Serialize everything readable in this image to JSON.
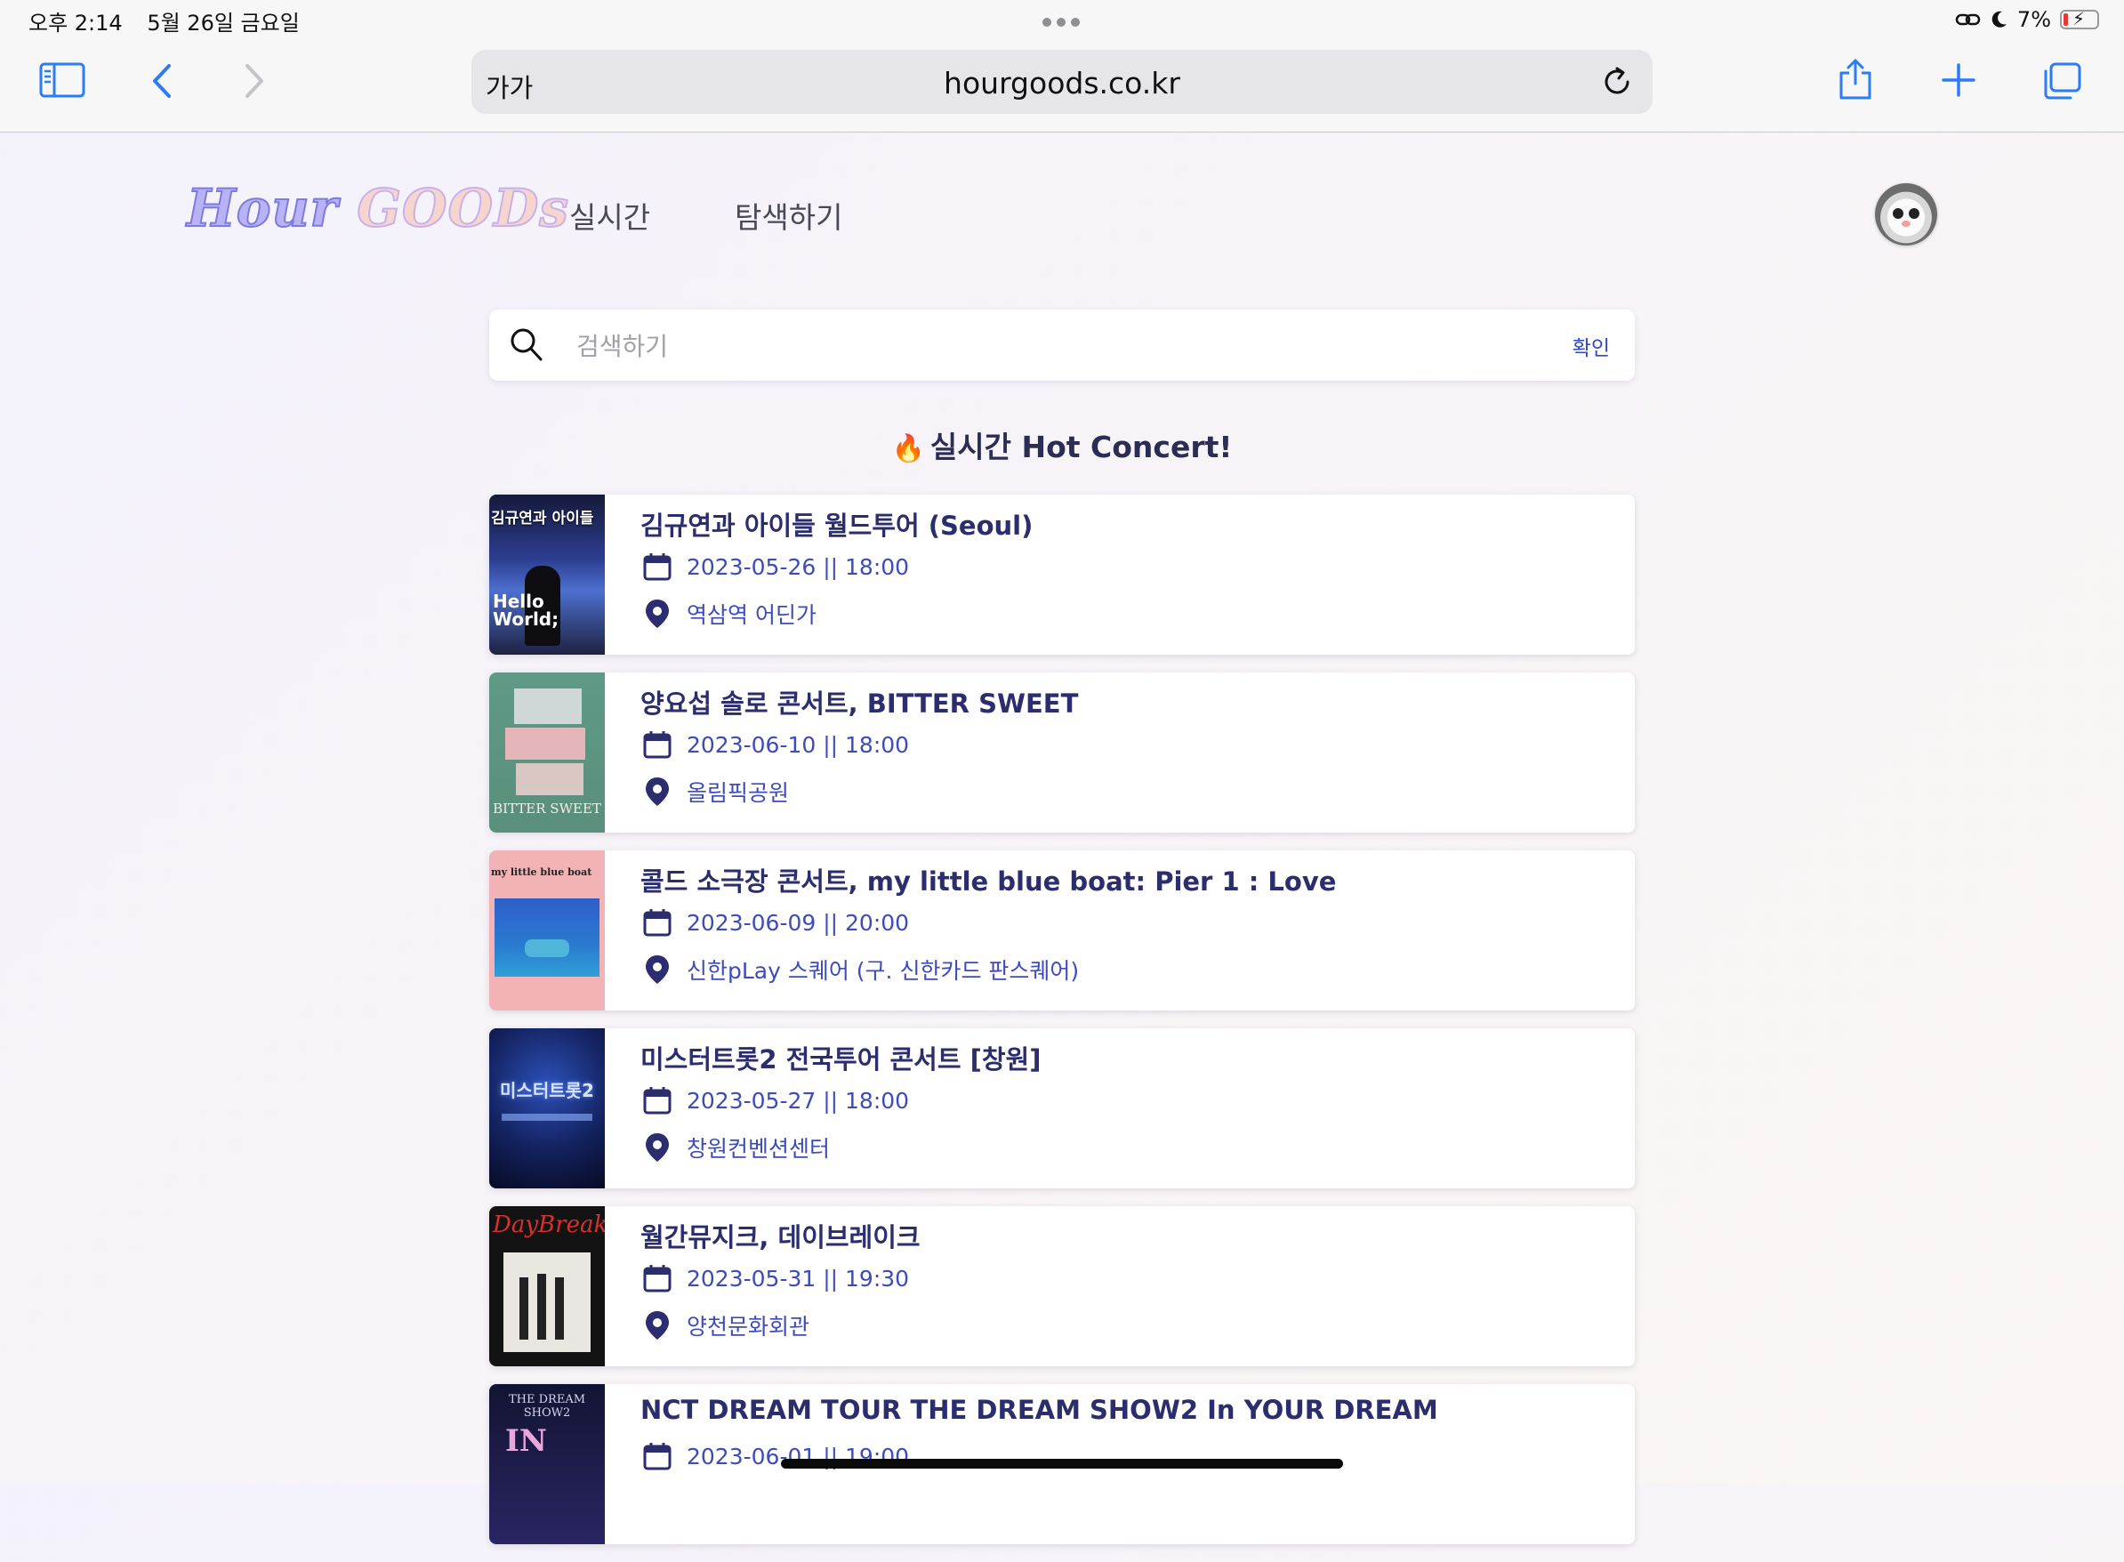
{
  "status": {
    "time": "오후 2:14",
    "date": "5월 26일 금요일",
    "battery": "7%"
  },
  "browser": {
    "text_size_label": "가가",
    "url": "hourgoods.co.kr"
  },
  "site": {
    "logo_word1": "Hour",
    "logo_word2": "GOODs",
    "nav": [
      "실시간",
      "탐색하기"
    ]
  },
  "search": {
    "placeholder": "검색하기",
    "value": "",
    "button_label": "확인"
  },
  "section": {
    "icon": "🔥",
    "title": "실시간 Hot Concert!"
  },
  "concerts": [
    {
      "title": "김규연과 아이들 월드투어 (Seoul)",
      "datetime": "2023-05-26 || 18:00",
      "place": "역삼역 어딘가",
      "poster_text": "김규연과 아이들"
    },
    {
      "title": "양요섭 솔로 콘서트, BITTER SWEET",
      "datetime": "2023-06-10 || 18:00",
      "place": "올림픽공원",
      "poster_text": "BITTER SWEET"
    },
    {
      "title": "콜드 소극장 콘서트, my little blue boat: Pier 1 : Love",
      "datetime": "2023-06-09 || 20:00",
      "place": "신한pLay 스퀘어 (구. 신한카드 판스퀘어)",
      "poster_text": "my little blue boat"
    },
    {
      "title": "미스터트롯2 전국투어 콘서트 [창원]",
      "datetime": "2023-05-27 || 18:00",
      "place": "창원컨벤션센터",
      "poster_text": "미스터트롯2"
    },
    {
      "title": "월간뮤지크, 데이브레이크",
      "datetime": "2023-05-31 || 19:30",
      "place": "양천문화회관",
      "poster_text": "DayBreak"
    },
    {
      "title": "NCT DREAM TOUR THE DREAM SHOW2 In YOUR DREAM",
      "datetime": "2023-06-01 || 19:00",
      "place": "",
      "poster_text": "THE DREAM SHOW2"
    }
  ],
  "colors": {
    "accent": "#2b2d6e",
    "link": "#3d4bbd",
    "button": "#2f47c9"
  }
}
